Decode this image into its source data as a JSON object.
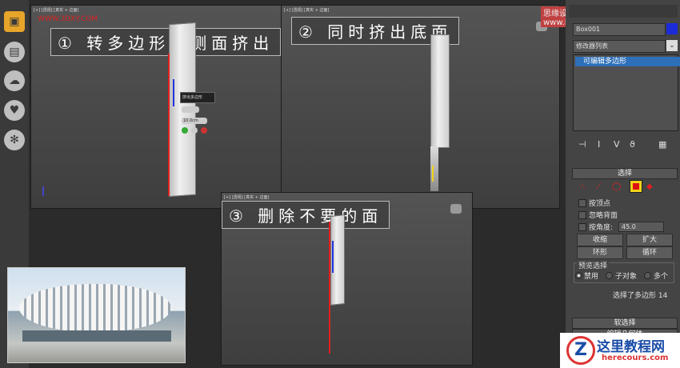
{
  "left_icons": [
    "box-icon",
    "document-icon",
    "cloud-icon",
    "heart-icon",
    "gear-icon"
  ],
  "viewport_labels": [
    "[+] [透视] [真实 + 边面]",
    "[+] [透视] [真实 + 边面]",
    "[+] [透视] [真实 + 边面]"
  ],
  "steps": {
    "step1": "① 转多边形。侧面挤出",
    "step2": "② 同时挤出底面",
    "step3": "③ 删除不要的面"
  },
  "caddy": {
    "title": "挤出多边形",
    "height_value": "10.0cm"
  },
  "watermarks": {
    "top_left": "WWW.3DXY.COM",
    "top_right": "思缘设计论坛 www.MISSYUAN.COM",
    "bottom_right_main": "这里教程网",
    "bottom_right_sub": "herecours.com",
    "bottom_right_logo_letter": "Z"
  },
  "command_panel": {
    "object_name": "Box001",
    "modifier_list": "修改器列表",
    "modifier_stack_item": "可编辑多边形",
    "select_rollout": "选择",
    "by_vertex": "按顶点",
    "ignore_backfacing": "忽略背面",
    "by_angle": "按角度:",
    "angle_value": "45.0",
    "shrink": "收缩",
    "grow": "扩大",
    "ring": "环形",
    "loop": "循环",
    "preview_selection": "预览选择",
    "disabled": "禁用",
    "sub_object": "子对象",
    "multi": "多个",
    "selection_status": "选择了多边形 14",
    "soft_selection": "软选择",
    "edit_geometry": "编辑几何体"
  },
  "colors": {
    "accent_blue": "#1a2bd8",
    "selection_red": "#e02020",
    "active_yellow": "#f2d21a"
  }
}
